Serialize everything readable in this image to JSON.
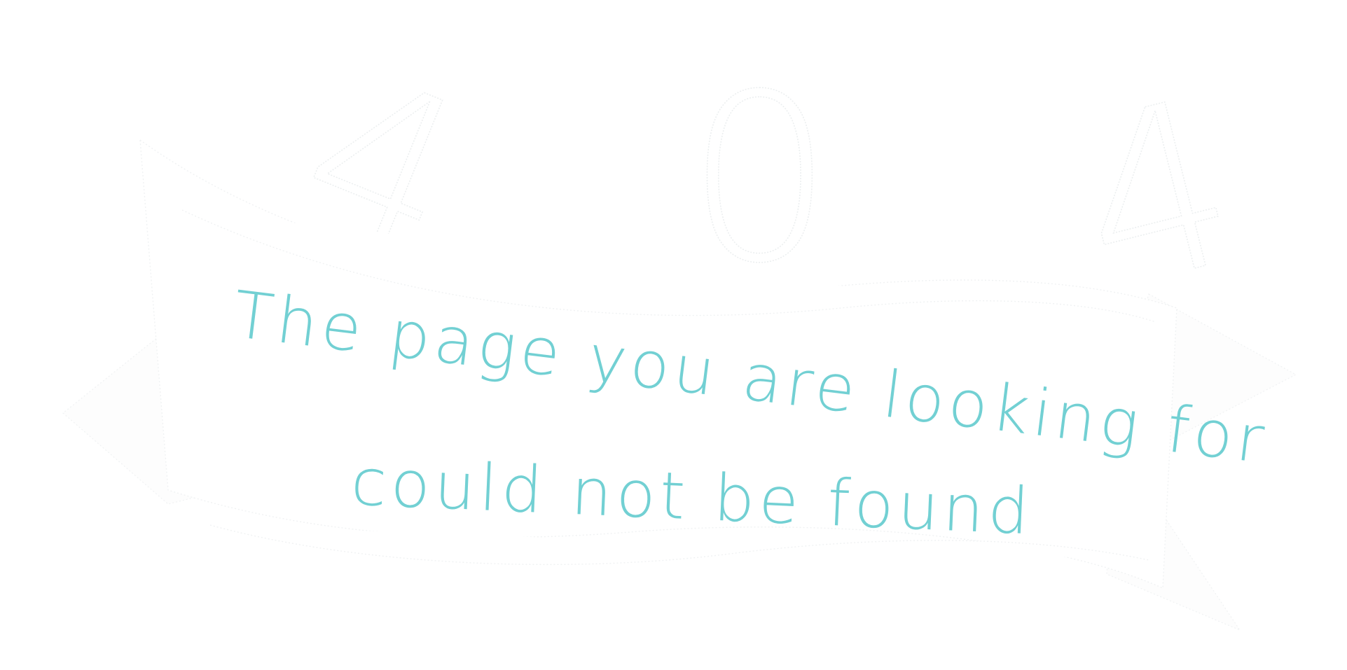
{
  "error": {
    "code_digits": [
      "4",
      "0",
      "4"
    ],
    "message_line_1": "The page you are looking for",
    "message_line_2": "could not be found"
  },
  "colors": {
    "message": "#72d0d3",
    "outline": "#eceff0",
    "background": "#ffffff"
  }
}
